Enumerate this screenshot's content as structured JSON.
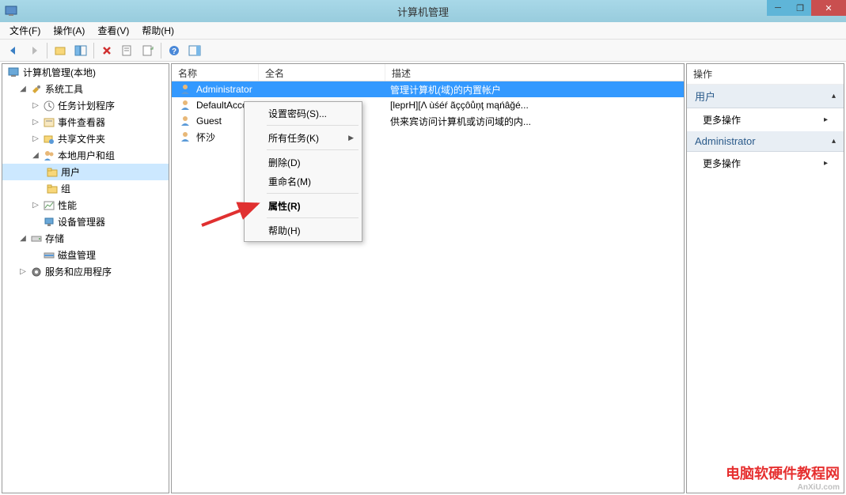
{
  "window": {
    "title": "计算机管理",
    "min_tooltip": "最小化",
    "max_tooltip": "最大化",
    "close_tooltip": "关闭"
  },
  "menubar": {
    "file": "文件(F)",
    "action": "操作(A)",
    "view": "查看(V)",
    "help": "帮助(H)"
  },
  "tree": {
    "root": "计算机管理(本地)",
    "system_tools": "系统工具",
    "task_scheduler": "任务计划程序",
    "event_viewer": "事件查看器",
    "shared_folders": "共享文件夹",
    "local_users_groups": "本地用户和组",
    "users": "用户",
    "groups": "组",
    "performance": "性能",
    "device_manager": "设备管理器",
    "storage": "存储",
    "disk_management": "磁盘管理",
    "services_apps": "服务和应用程序"
  },
  "list": {
    "col_name": "名称",
    "col_fullname": "全名",
    "col_desc": "描述",
    "rows": [
      {
        "name": "Administrator",
        "fullname": "",
        "desc": "管理计算机(域)的内置帐户"
      },
      {
        "name": "DefaultAccount",
        "fullname": "",
        "desc": "[leprH][Λ ùśéŕ ãççôůņţ mąńâğé..."
      },
      {
        "name": "Guest",
        "fullname": "",
        "desc": "供来宾访问计算机或访问域的内..."
      },
      {
        "name": "怀沙",
        "fullname": "",
        "desc": ""
      }
    ]
  },
  "actions": {
    "header": "操作",
    "section_users": "用户",
    "more_actions": "更多操作",
    "section_selected": "Administrator"
  },
  "ctx": {
    "set_password": "设置密码(S)...",
    "all_tasks": "所有任务(K)",
    "delete": "删除(D)",
    "rename": "重命名(M)",
    "properties": "属性(R)",
    "help": "帮助(H)"
  },
  "watermark": {
    "main": "电脑软硬件教程网",
    "sub": "AnXiU.com"
  }
}
